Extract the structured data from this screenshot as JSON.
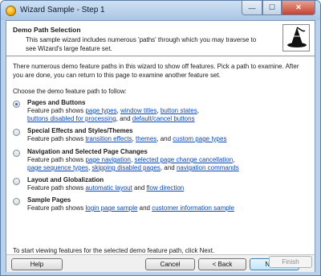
{
  "window": {
    "title": "Wizard Sample - Step 1",
    "caption_min": "—",
    "caption_max": "☐",
    "caption_close": "✕"
  },
  "header": {
    "title": "Demo Path Selection",
    "description": "This sample wizard includes numerous 'paths' through which you may traverse to see Wizard's large feature set."
  },
  "intro": "There numerous demo feature paths in this wizard to show off features. Pick a path to examine. After you are done, you can return to this page to examine another feature set.",
  "choose_label": "Choose the demo feature path to follow:",
  "options": [
    {
      "title": "Pages and Buttons",
      "selected": true,
      "prefix": "Feature path shows ",
      "links": [
        "page types",
        "window titles",
        "button states",
        "buttons disabled for processing",
        "default/cancel buttons"
      ],
      "seps": [
        ", ",
        ", ",
        ",",
        ", and "
      ]
    },
    {
      "title": "Special Effects and Styles/Themes",
      "selected": false,
      "prefix": "Feature path shows ",
      "links": [
        "transition effects",
        "themes",
        "custom page types"
      ],
      "seps": [
        ", ",
        ", and "
      ]
    },
    {
      "title": "Navigation and Selected Page Changes",
      "selected": false,
      "prefix": "Feature path shows ",
      "links": [
        "page navigation",
        "selected page change cancellation",
        "page sequence types",
        "skipping disabled pages",
        "navigation commands"
      ],
      "seps": [
        ", ",
        ",",
        ", ",
        ", and "
      ]
    },
    {
      "title": "Layout and Globalization",
      "selected": false,
      "prefix": "Feature path shows ",
      "links": [
        "automatic layout",
        "flow direction"
      ],
      "seps": [
        " and "
      ]
    },
    {
      "title": "Sample Pages",
      "selected": false,
      "prefix": "Feature path shows ",
      "links": [
        "login page sample",
        "customer information sample"
      ],
      "seps": [
        " and "
      ]
    }
  ],
  "footer_note": "To start viewing features for the selected demo feature path, click Next.",
  "buttons": {
    "help": "Help",
    "cancel": "Cancel",
    "back": "< Back",
    "next": "Next >",
    "finish": "Finish"
  },
  "icons": {
    "app": "wizard-app-icon",
    "header": "wizard-hat-icon"
  },
  "colors": {
    "link": "#0b48b8",
    "radio_selected": "#2e6fc4"
  }
}
